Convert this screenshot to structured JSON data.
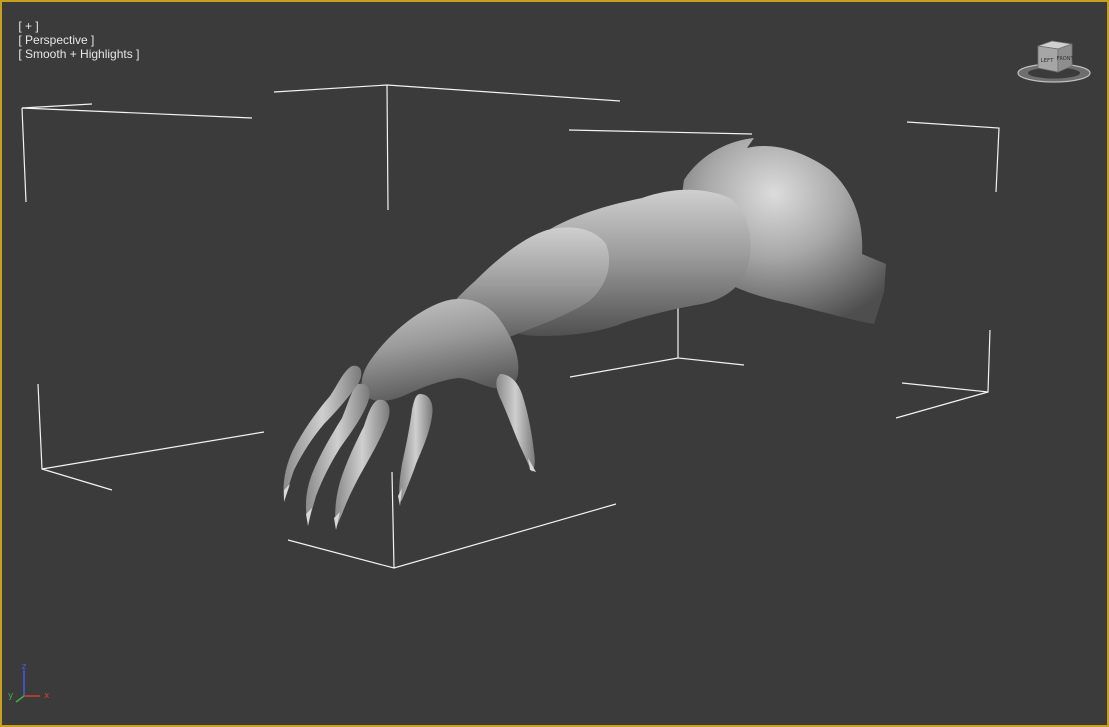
{
  "viewport": {
    "label_plus": "[ + ]",
    "label_view": "[ Perspective ]",
    "label_shading": "[ Smooth + Highlights ]",
    "border_color": "#c8a020",
    "background": "#3b3b3b"
  },
  "viewcube": {
    "face_left": "LEFT",
    "face_front": "FRONT",
    "icon": "viewcube-icon"
  },
  "axis_tripod": {
    "x": "x",
    "y": "y",
    "z": "z",
    "x_color": "#d04030",
    "y_color": "#40b040",
    "z_color": "#4060e0"
  }
}
